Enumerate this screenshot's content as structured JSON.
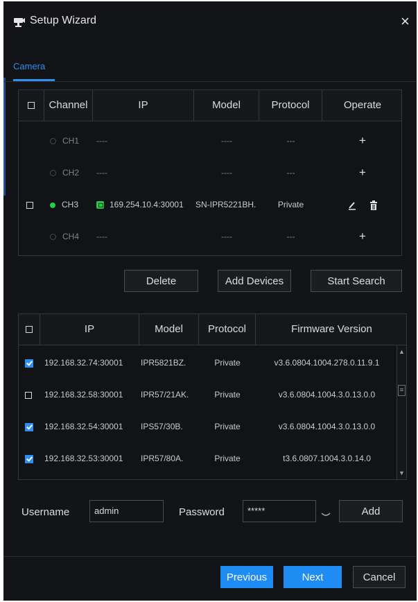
{
  "dialog": {
    "title": "Setup Wizard",
    "close_glyph": "×"
  },
  "tabs": [
    {
      "label": "Camera",
      "active": true
    }
  ],
  "channel_table": {
    "headers": [
      "Channel",
      "IP",
      "Model",
      "Protocol",
      "Operate"
    ],
    "rows": [
      {
        "channel": "CH1",
        "online": false,
        "ip": "----",
        "model": "----",
        "protocol": "---",
        "operate": "+"
      },
      {
        "channel": "CH2",
        "online": false,
        "ip": "----",
        "model": "----",
        "protocol": "---",
        "operate": "+"
      },
      {
        "channel": "CH3",
        "online": true,
        "checkbox": true,
        "ip": "169.254.10.4:30001",
        "model": "SN-IPR5221BH.",
        "protocol": "Private",
        "operate": "edit-delete"
      },
      {
        "channel": "CH4",
        "online": false,
        "ip": "----",
        "model": "----",
        "protocol": "---",
        "operate": "+"
      }
    ]
  },
  "actions": {
    "delete": "Delete",
    "add_devices": "Add Devices",
    "start_search": "Start Search"
  },
  "search_table": {
    "headers": [
      "IP",
      "Model",
      "Protocol",
      "Firmware Version"
    ],
    "rows": [
      {
        "checked": true,
        "ip": "192.168.32.74:30001",
        "model": "IPR5821BZ.",
        "protocol": "Private",
        "firmware": "v3.6.0804.1004.278.0.11.9.1"
      },
      {
        "checked": false,
        "ip": "192.168.32.58:30001",
        "model": "IPR57/21AK.",
        "protocol": "Private",
        "firmware": "v3.6.0804.1004.3.0.13.0.0"
      },
      {
        "checked": true,
        "ip": "192.168.32.54:30001",
        "model": "IPS57/30B.",
        "protocol": "Private",
        "firmware": "v3.6.0804.1004.3.0.13.0.0"
      },
      {
        "checked": true,
        "ip": "192.168.32.53:30001",
        "model": "IPR57/80A.",
        "protocol": "Private",
        "firmware": "t3.6.0807.1004.3.0.14.0"
      }
    ]
  },
  "credentials": {
    "username_label": "Username",
    "username_value": "admin",
    "password_label": "Password",
    "password_value": "*****",
    "add_label": "Add"
  },
  "footer": {
    "previous": "Previous",
    "next": "Next",
    "cancel": "Cancel"
  },
  "colors": {
    "accent": "#1e8cf2",
    "online": "#21d04a",
    "background": "#121417",
    "border": "#34383d"
  }
}
